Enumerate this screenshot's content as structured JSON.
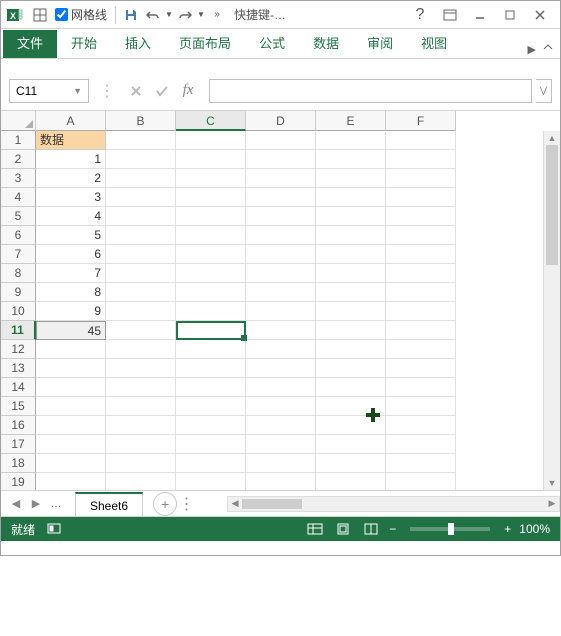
{
  "titlebar": {
    "gridlines_label": "网格线",
    "doc_title": "快捷键-…"
  },
  "ribbon": {
    "tabs": [
      "文件",
      "开始",
      "插入",
      "页面布局",
      "公式",
      "数据",
      "审阅",
      "视图"
    ]
  },
  "name_box": "C11",
  "columns": [
    "A",
    "B",
    "C",
    "D",
    "E",
    "F"
  ],
  "rows": {
    "count": 19,
    "data_header": "数据",
    "values": [
      "1",
      "2",
      "3",
      "4",
      "5",
      "6",
      "7",
      "8",
      "9"
    ],
    "sum_row": 11,
    "sum_value": "45",
    "active_col_index": 2,
    "active_row": 11
  },
  "sheet_tab": "Sheet6",
  "status": {
    "ready": "就绪",
    "zoom": "100%"
  },
  "chart_data": {
    "type": "table",
    "title": "数据",
    "columns": [
      "数据"
    ],
    "rows": [
      [
        1
      ],
      [
        2
      ],
      [
        3
      ],
      [
        4
      ],
      [
        5
      ],
      [
        6
      ],
      [
        7
      ],
      [
        8
      ],
      [
        9
      ]
    ],
    "sum": 45
  }
}
